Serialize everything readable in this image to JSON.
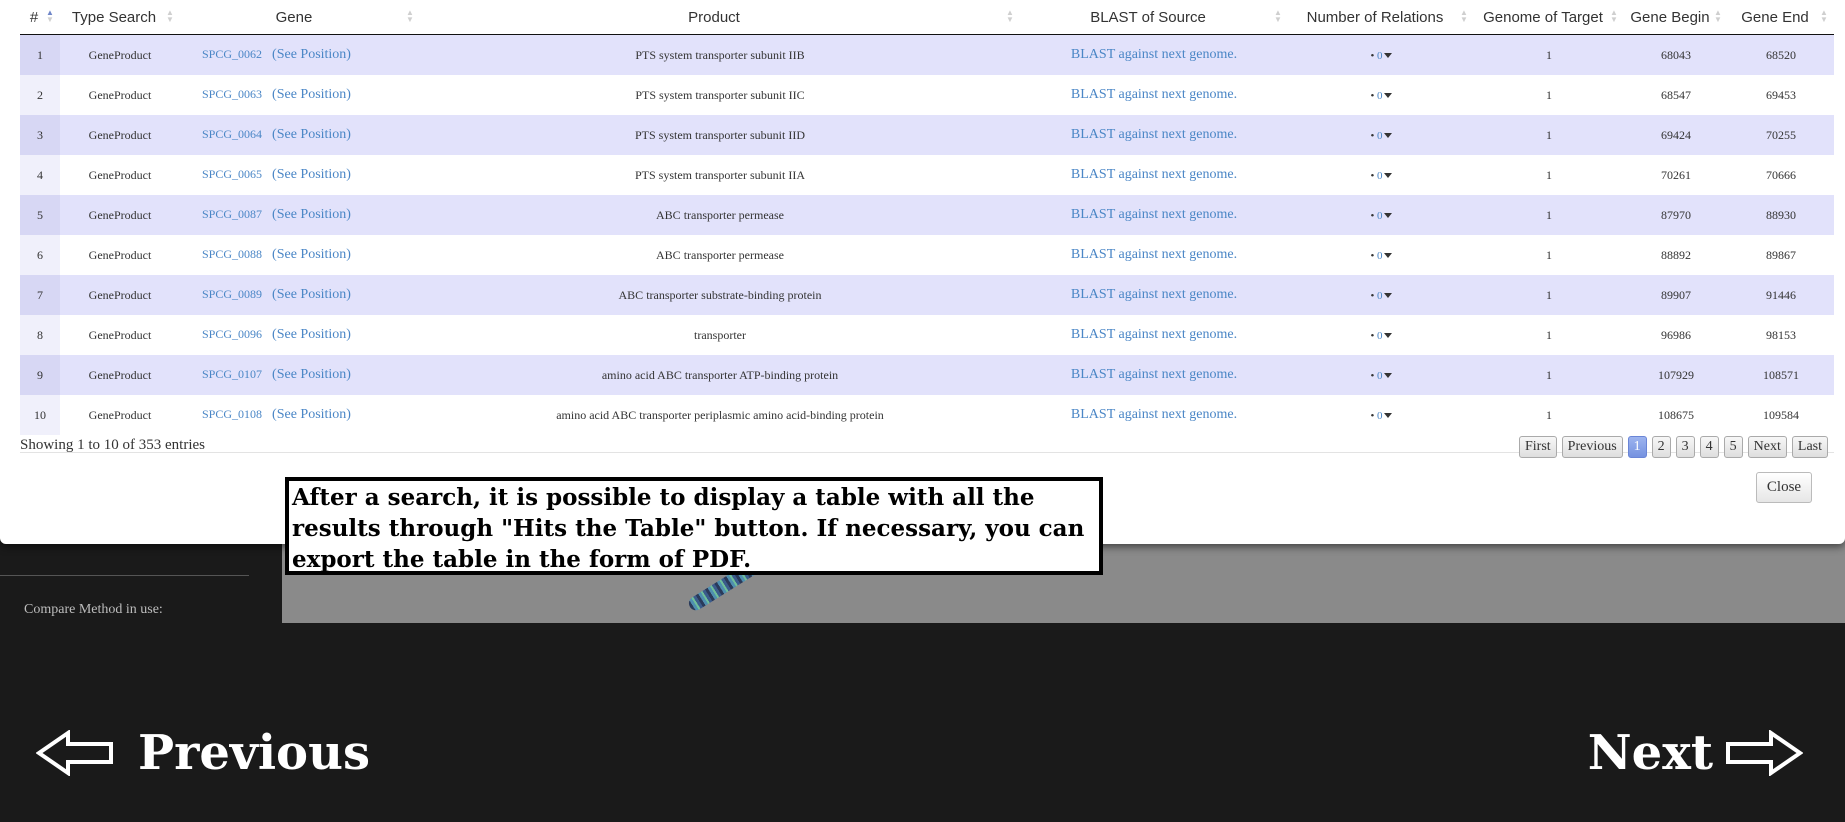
{
  "table": {
    "columns": [
      {
        "label": "#",
        "sorted": "asc"
      },
      {
        "label": "Type Search"
      },
      {
        "label": "Gene"
      },
      {
        "label": "Product"
      },
      {
        "label": "BLAST of Source"
      },
      {
        "label": "Number of Relations"
      },
      {
        "label": "Genome of Target"
      },
      {
        "label": "Gene Begin"
      },
      {
        "label": "Gene End"
      }
    ],
    "position_link": "(See Position)",
    "blast_link": "BLAST against next genome.",
    "rows": [
      {
        "idx": "1",
        "type": "GeneProduct",
        "gene": "SPCG_0062",
        "product": "PTS system transporter subunit IIB",
        "relations": "0",
        "target": "1",
        "begin": "68043",
        "end": "68520"
      },
      {
        "idx": "2",
        "type": "GeneProduct",
        "gene": "SPCG_0063",
        "product": "PTS system transporter subunit IIC",
        "relations": "0",
        "target": "1",
        "begin": "68547",
        "end": "69453"
      },
      {
        "idx": "3",
        "type": "GeneProduct",
        "gene": "SPCG_0064",
        "product": "PTS system transporter subunit IID",
        "relations": "0",
        "target": "1",
        "begin": "69424",
        "end": "70255"
      },
      {
        "idx": "4",
        "type": "GeneProduct",
        "gene": "SPCG_0065",
        "product": "PTS system transporter subunit IIA",
        "relations": "0",
        "target": "1",
        "begin": "70261",
        "end": "70666"
      },
      {
        "idx": "5",
        "type": "GeneProduct",
        "gene": "SPCG_0087",
        "product": "ABC transporter permease",
        "relations": "0",
        "target": "1",
        "begin": "87970",
        "end": "88930"
      },
      {
        "idx": "6",
        "type": "GeneProduct",
        "gene": "SPCG_0088",
        "product": "ABC transporter permease",
        "relations": "0",
        "target": "1",
        "begin": "88892",
        "end": "89867"
      },
      {
        "idx": "7",
        "type": "GeneProduct",
        "gene": "SPCG_0089",
        "product": "ABC transporter substrate-binding protein",
        "relations": "0",
        "target": "1",
        "begin": "89907",
        "end": "91446"
      },
      {
        "idx": "8",
        "type": "GeneProduct",
        "gene": "SPCG_0096",
        "product": "transporter",
        "relations": "0",
        "target": "1",
        "begin": "96986",
        "end": "98153"
      },
      {
        "idx": "9",
        "type": "GeneProduct",
        "gene": "SPCG_0107",
        "product": "amino acid ABC transporter ATP-binding protein",
        "relations": "0",
        "target": "1",
        "begin": "107929",
        "end": "108571"
      },
      {
        "idx": "10",
        "type": "GeneProduct",
        "gene": "SPCG_0108",
        "product": "amino acid ABC transporter periplasmic amino acid-binding protein",
        "relations": "0",
        "target": "1",
        "begin": "108675",
        "end": "109584"
      }
    ],
    "info": "Showing 1 to 10 of 353 entries"
  },
  "pager": {
    "first": "First",
    "previous": "Previous",
    "pages": [
      "1",
      "2",
      "3",
      "4",
      "5"
    ],
    "current": "1",
    "next": "Next",
    "last": "Last"
  },
  "modal": {
    "close_label": "Close"
  },
  "callout": {
    "text": "After a search, it is possible to display a table with all the results through \"Hits the Table\" button. If necessary, you can export the table in the form of PDF."
  },
  "background": {
    "compare_label": "Compare Method in use:"
  },
  "tutorial_nav": {
    "previous": "Previous",
    "next": "Next"
  },
  "colors": {
    "link": "#4a86c6",
    "row_odd": "#e2e2fb",
    "page_bg": "#1a1a1a",
    "current_page": "#7592e0"
  }
}
